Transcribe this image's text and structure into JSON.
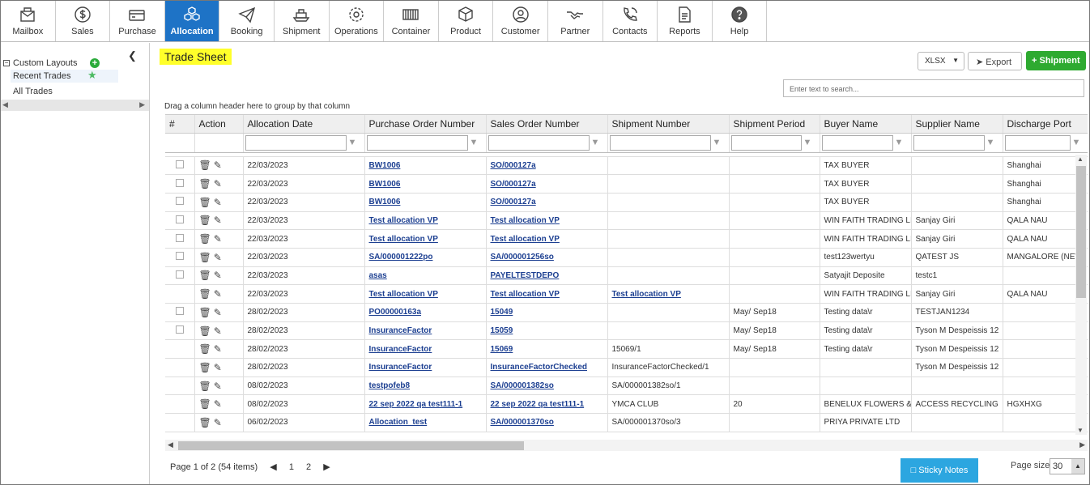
{
  "nav": [
    {
      "label": "Mailbox",
      "icon": "mailbox-icon"
    },
    {
      "label": "Sales",
      "icon": "dollar-icon"
    },
    {
      "label": "Purchase",
      "icon": "wallet-icon"
    },
    {
      "label": "Allocation",
      "icon": "cubes-icon",
      "active": true
    },
    {
      "label": "Booking",
      "icon": "paper-plane-icon"
    },
    {
      "label": "Shipment",
      "icon": "ship-icon"
    },
    {
      "label": "Operations",
      "icon": "gear-icon"
    },
    {
      "label": "Container",
      "icon": "container-icon"
    },
    {
      "label": "Product",
      "icon": "box-icon"
    },
    {
      "label": "Customer",
      "icon": "user-icon"
    },
    {
      "label": "Partner",
      "icon": "handshake-icon"
    },
    {
      "label": "Contacts",
      "icon": "phone-icon"
    },
    {
      "label": "Reports",
      "icon": "report-icon"
    },
    {
      "label": "Help",
      "icon": "help-icon"
    }
  ],
  "sidebar": {
    "custom_layouts": "Custom Layouts",
    "recent_trades": "Recent Trades",
    "all_trades": "All Trades"
  },
  "page": {
    "title": "Trade Sheet",
    "format": "XLSX",
    "export": "Export",
    "shipment_button": "Shipment",
    "search_placeholder": "Enter text to search...",
    "group_hint": "Drag a column header here to group by that column"
  },
  "columns": [
    "#",
    "Action",
    "Allocation Date",
    "Purchase Order Number",
    "Sales Order Number",
    "Shipment Number",
    "Shipment Period",
    "Buyer Name",
    "Supplier Name",
    "Discharge Port"
  ],
  "rows": [
    {
      "chk": true,
      "date": "22/03/2023",
      "po": "BW1006",
      "so": "SO/000127a",
      "ship": "",
      "ship_link": false,
      "period": "",
      "buyer": "TAX BUYER",
      "supplier": "",
      "port": "Shanghai"
    },
    {
      "chk": true,
      "date": "22/03/2023",
      "po": "BW1006",
      "so": "SO/000127a",
      "ship": "",
      "ship_link": false,
      "period": "",
      "buyer": "TAX BUYER",
      "supplier": "",
      "port": "Shanghai"
    },
    {
      "chk": true,
      "date": "22/03/2023",
      "po": "BW1006",
      "so": "SO/000127a",
      "ship": "",
      "ship_link": false,
      "period": "",
      "buyer": "TAX BUYER",
      "supplier": "",
      "port": "Shanghai"
    },
    {
      "chk": true,
      "date": "22/03/2023",
      "po": "Test allocation VP",
      "so": "Test allocation VP",
      "ship": "",
      "ship_link": false,
      "period": "",
      "buyer": "WIN FAITH TRADING LI...",
      "supplier": "Sanjay Giri",
      "port": "QALA NAU"
    },
    {
      "chk": true,
      "date": "22/03/2023",
      "po": "Test allocation VP",
      "so": "Test allocation VP",
      "ship": "",
      "ship_link": false,
      "period": "",
      "buyer": "WIN FAITH TRADING LI...",
      "supplier": "Sanjay Giri",
      "port": "QALA NAU"
    },
    {
      "chk": true,
      "date": "22/03/2023",
      "po": "SA/000001222po",
      "so": "SA/000001256so",
      "ship": "",
      "ship_link": false,
      "period": "",
      "buyer": "test123wertyu",
      "supplier": "QATEST JS",
      "port": "MANGALORE (NEW I"
    },
    {
      "chk": true,
      "date": "22/03/2023",
      "po": "asas",
      "so": "PAYELTESTDEPO",
      "ship": "",
      "ship_link": false,
      "period": "",
      "buyer": "Satyajit Deposite",
      "supplier": "testc1",
      "port": ""
    },
    {
      "chk": false,
      "date": "22/03/2023",
      "po": "Test allocation VP",
      "so": "Test allocation VP",
      "ship": "Test allocation VP",
      "ship_link": true,
      "period": "",
      "buyer": "WIN FAITH TRADING LI...",
      "supplier": "Sanjay Giri",
      "port": "QALA NAU"
    },
    {
      "chk": true,
      "date": "28/02/2023",
      "po": "PO00000163a",
      "so": "15049",
      "ship": "",
      "ship_link": false,
      "period": "May/ Sep18",
      "buyer": "Testing data\\r",
      "supplier": "TESTJAN1234",
      "port": ""
    },
    {
      "chk": true,
      "date": "28/02/2023",
      "po": "InsuranceFactor",
      "so": "15059",
      "ship": "",
      "ship_link": false,
      "period": "May/ Sep18",
      "buyer": "Testing data\\r",
      "supplier": "Tyson M Despeissis 12",
      "port": ""
    },
    {
      "chk": false,
      "date": "28/02/2023",
      "po": "InsuranceFactor",
      "so": "15069",
      "ship": "15069/1",
      "ship_link": false,
      "period": "May/ Sep18",
      "buyer": "Testing data\\r",
      "supplier": "Tyson M Despeissis 12",
      "port": ""
    },
    {
      "chk": false,
      "date": "28/02/2023",
      "po": "InsuranceFactor",
      "so": "InsuranceFactorChecked",
      "ship": "InsuranceFactorChecked/1",
      "ship_link": false,
      "period": "",
      "buyer": "",
      "supplier": "Tyson M Despeissis 12",
      "port": ""
    },
    {
      "chk": false,
      "date": "08/02/2023",
      "po": "testpofeb8",
      "so": "SA/000001382so",
      "ship": "SA/000001382so/1",
      "ship_link": false,
      "period": "",
      "buyer": "",
      "supplier": "",
      "port": ""
    },
    {
      "chk": false,
      "date": "08/02/2023",
      "po": "22 sep 2022 qa test111-1",
      "so": "22 sep 2022 qa test111-1",
      "ship": "YMCA CLUB",
      "ship_link": false,
      "period": "20",
      "buyer": "BENELUX FLOWERS & ...",
      "supplier": "ACCESS RECYCLING",
      "port": "HGXHXG"
    },
    {
      "chk": false,
      "date": "06/02/2023",
      "po": "Allocation_test",
      "so": "SA/000001370so",
      "ship": "SA/000001370so/3",
      "ship_link": false,
      "period": "",
      "buyer": "PRIYA PRIVATE LTD",
      "supplier": "",
      "port": ""
    }
  ],
  "pager": {
    "summary": "Page 1 of 2 (54 items)",
    "page1": "1",
    "page2": "2",
    "sticky": "Sticky Notes",
    "page_size_label": "Page size:",
    "page_size": "30"
  }
}
